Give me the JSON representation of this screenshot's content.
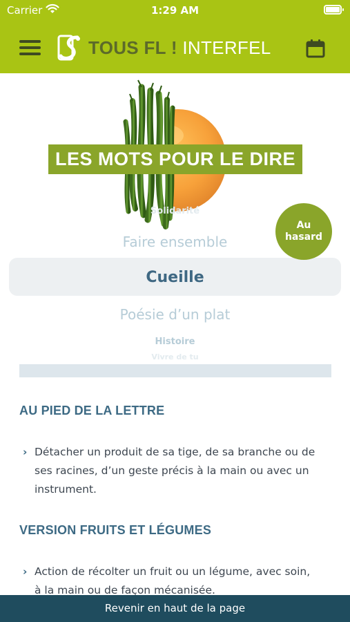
{
  "status_bar": {
    "carrier": "Carrier",
    "time": "1:29 AM"
  },
  "header": {
    "brand_bold": "TOUS FL !",
    "brand_light": "INTERFEL",
    "menu_icon": "hamburger-icon",
    "calendar_icon": "calendar-icon"
  },
  "hero": {
    "title": "LES MOTS POUR LE DIRE"
  },
  "random_button": {
    "line1": "Au",
    "line2": "hasard"
  },
  "picker": {
    "far_above": "Solidarité",
    "above": "Faire ensemble",
    "selected": "Cueille",
    "below": "Poésie d’un plat",
    "far_below": "Histoire",
    "farthest_below": "Vivre de tu"
  },
  "content": {
    "section1_title": "AU PIED DE LA LETTRE",
    "section1_text": "Détacher un produit de sa tige, de sa branche ou de ses racines, d’un geste précis à la main ou avec un instrument.",
    "section2_title": "VERSION FRUITS ET LÉGUMES",
    "section2_text": "Action de récolter un fruit ou un légume, avec soin, à la main ou de façon mécanisée."
  },
  "footer": {
    "label": "Revenir en haut de la page"
  },
  "colors": {
    "brand_green": "#a9c414",
    "olive": "#8aa52a",
    "teal_text": "#3d6a84",
    "footer_bg": "#1f4c5e"
  }
}
